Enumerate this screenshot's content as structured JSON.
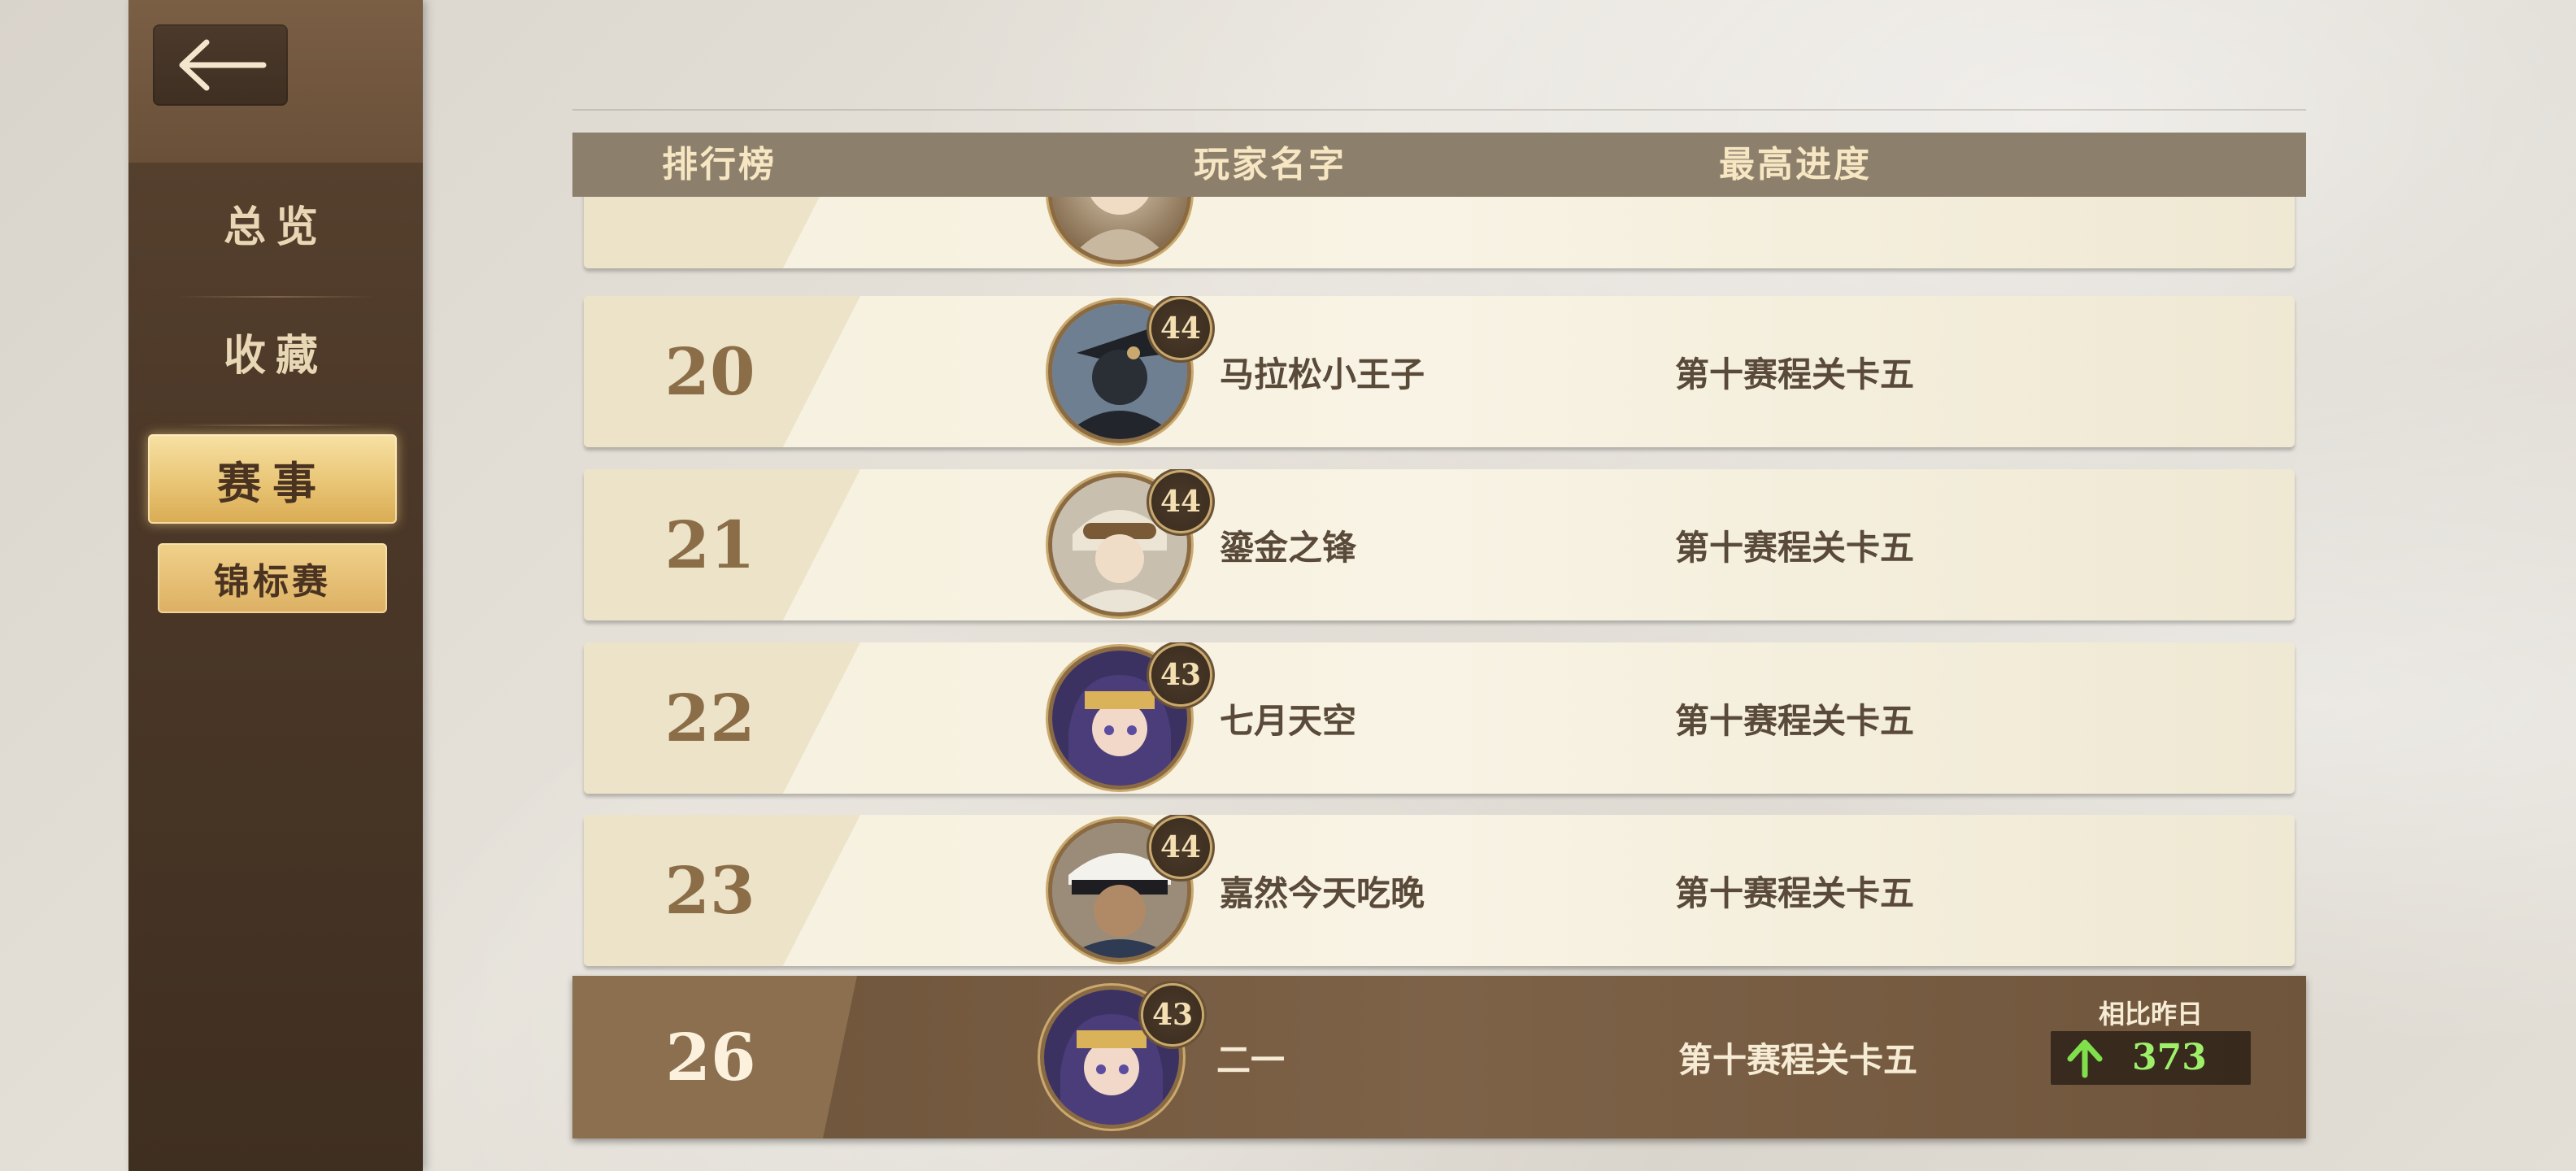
{
  "sidebar": {
    "nav": [
      {
        "label": "总览"
      },
      {
        "label": "收藏"
      },
      {
        "label": "赛事"
      }
    ],
    "sub": {
      "label": "锦标赛"
    }
  },
  "header": {
    "col_rank": "排行榜",
    "col_name": "玩家名字",
    "col_progress": "最高进度"
  },
  "rows": [
    {
      "rank": "",
      "name": "",
      "progress": "",
      "level": ""
    },
    {
      "rank": "20",
      "name": "马拉松小王子",
      "progress": "第十赛程关卡五",
      "level": "44"
    },
    {
      "rank": "21",
      "name": "鎏金之锋",
      "progress": "第十赛程关卡五",
      "level": "44"
    },
    {
      "rank": "22",
      "name": "七月天空",
      "progress": "第十赛程关卡五",
      "level": "43"
    },
    {
      "rank": "23",
      "name": "嘉然今天吃晚",
      "progress": "第十赛程关卡五",
      "level": "44"
    }
  ],
  "self": {
    "rank": "26",
    "name": "二一",
    "progress": "第十赛程关卡五",
    "level": "43",
    "compare_label": "相比昨日",
    "compare_value": "373"
  },
  "colors": {
    "accent_gold": "#e9c575",
    "up_green": "#9ef06a",
    "sidebar_brown": "#4c3828"
  }
}
